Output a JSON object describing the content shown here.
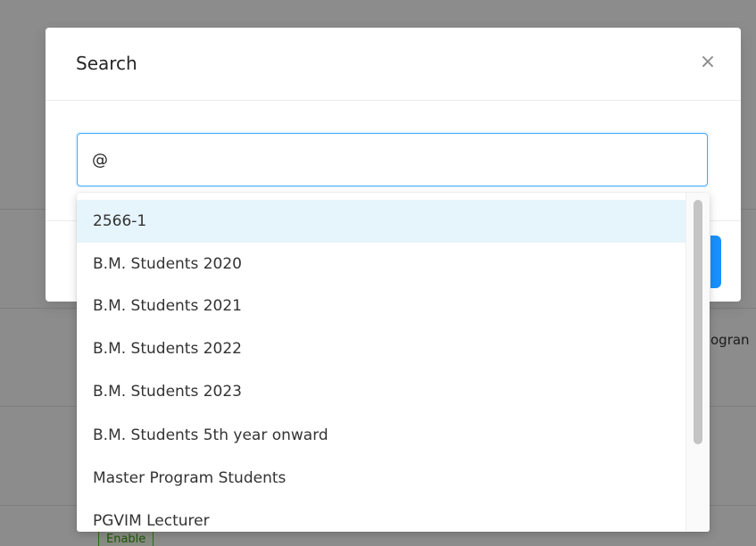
{
  "background": {
    "side_text": "ogran",
    "badge": "Enable"
  },
  "modal": {
    "title": "Search",
    "close_icon": "×"
  },
  "search": {
    "value": "@"
  },
  "dropdown": {
    "options": [
      "2566-1",
      "B.M. Students 2020",
      "B.M. Students 2021",
      "B.M. Students 2022",
      "B.M. Students 2023",
      "B.M. Students 5th year onward",
      "Master Program Students",
      "PGVIM Lecturer"
    ],
    "active_index": 0
  },
  "colors": {
    "accent": "#1890ff",
    "active_option": "#e6f4fb",
    "badge_green": "#52c41a"
  }
}
